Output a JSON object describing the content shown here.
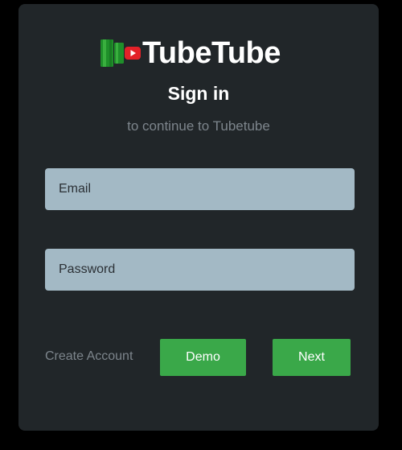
{
  "brand": {
    "name": "TubeTube",
    "logo_icon": "green-pipe-with-play-icon",
    "accent_color": "#3aa849",
    "play_color": "#e32128"
  },
  "header": {
    "title": "Sign in",
    "subtitle": "to continue to Tubetube"
  },
  "form": {
    "email_placeholder": "Email",
    "email_value": "",
    "password_placeholder": "Password",
    "password_value": ""
  },
  "actions": {
    "create_account_label": "Create Account",
    "demo_label": "Demo",
    "next_label": "Next"
  }
}
